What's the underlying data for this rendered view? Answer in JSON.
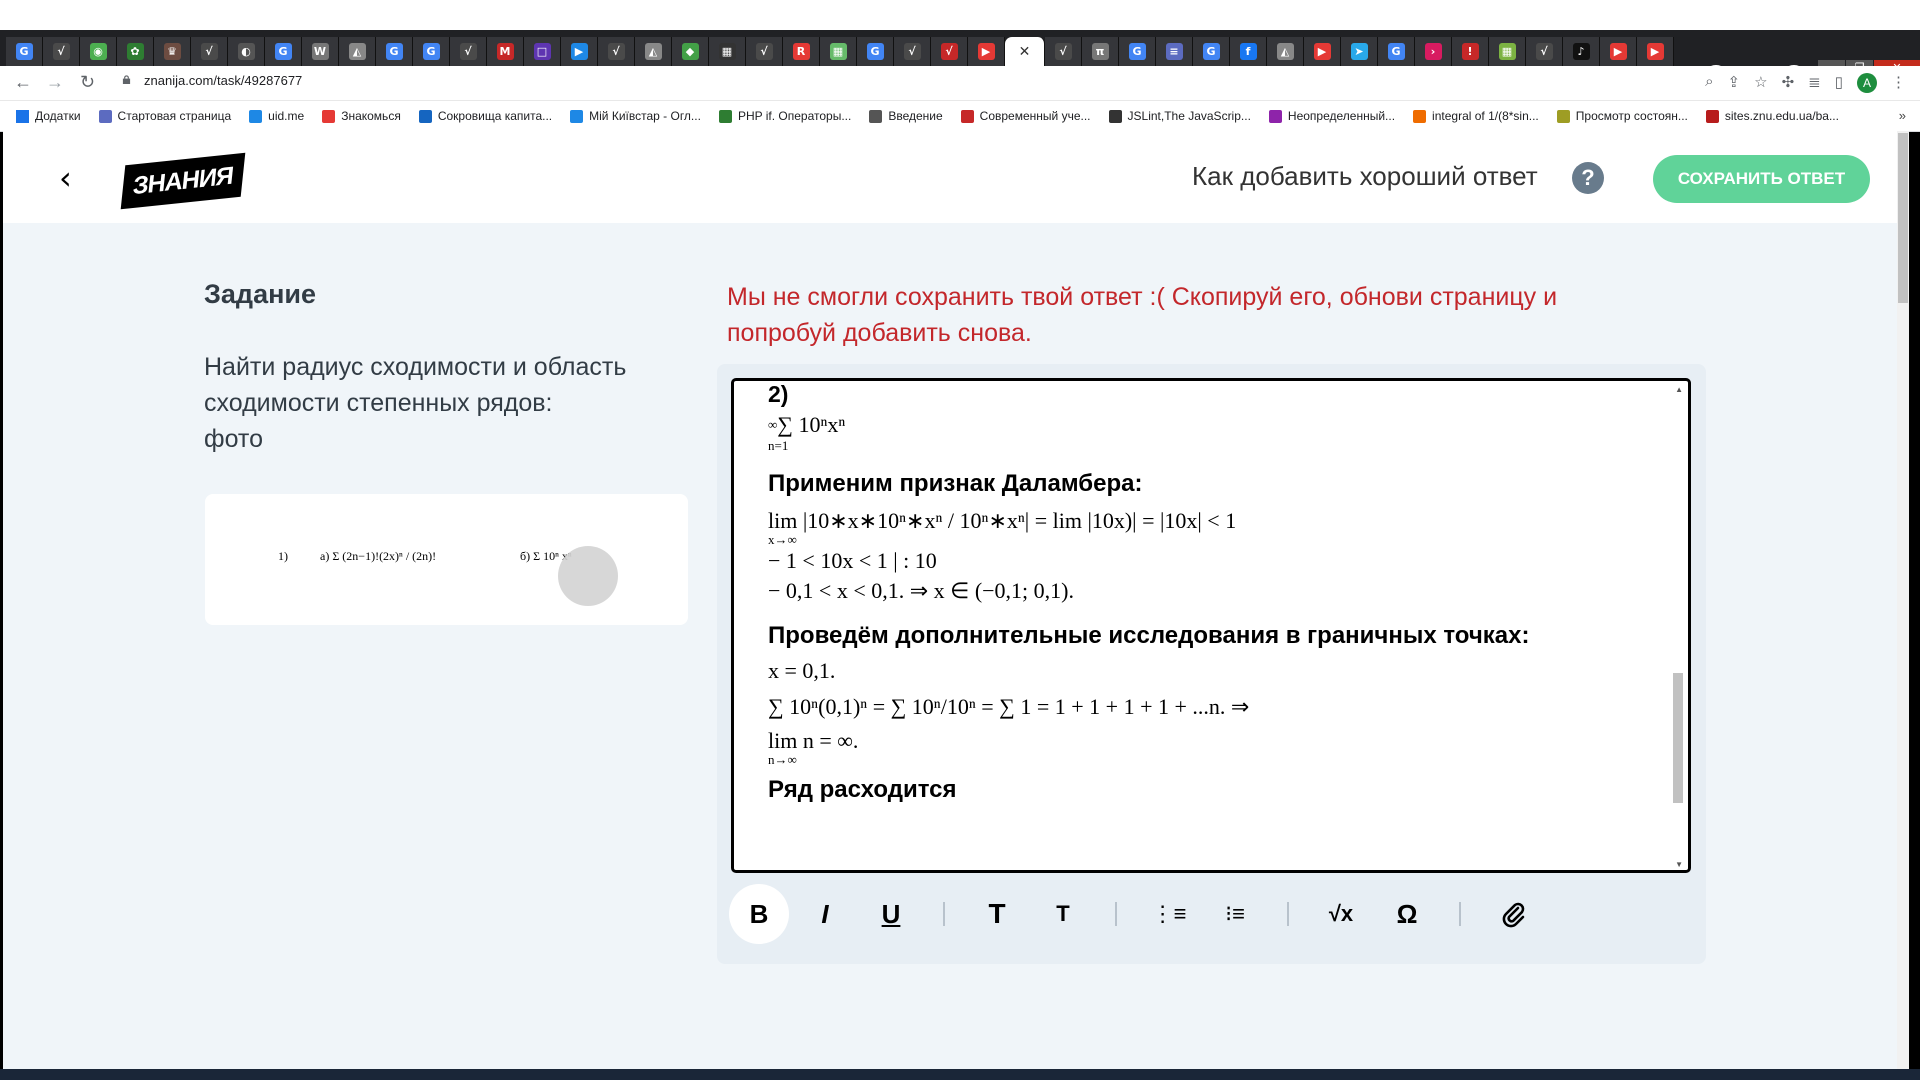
{
  "browser": {
    "url": "znanija.com/task/49287677",
    "tab_favicons": [
      {
        "glyph": "G",
        "color": "#4285f4"
      },
      {
        "glyph": "√",
        "color": "#4a4a4a"
      },
      {
        "glyph": "◉",
        "color": "#4caf50"
      },
      {
        "glyph": "✿",
        "color": "#2e7d32"
      },
      {
        "glyph": "♛",
        "color": "#6d4c41"
      },
      {
        "glyph": "√",
        "color": "#4a4a4a"
      },
      {
        "glyph": "◐",
        "color": "#555"
      },
      {
        "glyph": "G",
        "color": "#4285f4"
      },
      {
        "glyph": "W",
        "color": "#777"
      },
      {
        "glyph": "◭",
        "color": "#888"
      },
      {
        "glyph": "G",
        "color": "#4285f4"
      },
      {
        "glyph": "G",
        "color": "#4285f4"
      },
      {
        "glyph": "√",
        "color": "#4a4a4a"
      },
      {
        "glyph": "M",
        "color": "#c62828"
      },
      {
        "glyph": "□",
        "color": "#5e35b1"
      },
      {
        "glyph": "▶",
        "color": "#1e88e5"
      },
      {
        "glyph": "√",
        "color": "#4a4a4a"
      },
      {
        "glyph": "◭",
        "color": "#888"
      },
      {
        "glyph": "◆",
        "color": "#43a047"
      },
      {
        "glyph": "▦",
        "color": "#333"
      },
      {
        "glyph": "√",
        "color": "#4a4a4a"
      },
      {
        "glyph": "R",
        "color": "#e53935"
      },
      {
        "glyph": "▦",
        "color": "#66bb6a"
      },
      {
        "glyph": "G",
        "color": "#4285f4"
      },
      {
        "glyph": "√",
        "color": "#4a4a4a"
      },
      {
        "glyph": "√",
        "color": "#c62828"
      },
      {
        "glyph": "▶",
        "color": "#e53935"
      },
      {
        "glyph": "✕",
        "color": "#333"
      },
      {
        "glyph": "√",
        "color": "#4a4a4a"
      },
      {
        "glyph": "π",
        "color": "#777"
      },
      {
        "glyph": "G",
        "color": "#4285f4"
      },
      {
        "glyph": "≡",
        "color": "#5c6bc0"
      },
      {
        "glyph": "G",
        "color": "#4285f4"
      },
      {
        "glyph": "f",
        "color": "#1877f2"
      },
      {
        "glyph": "◭",
        "color": "#888"
      },
      {
        "glyph": "▶",
        "color": "#e53935"
      },
      {
        "glyph": "➤",
        "color": "#29a9ea"
      },
      {
        "glyph": "G",
        "color": "#4285f4"
      },
      {
        "glyph": "›",
        "color": "#d81b60"
      },
      {
        "glyph": "!",
        "color": "#c62828"
      },
      {
        "glyph": "▦",
        "color": "#7cb342"
      },
      {
        "glyph": "√",
        "color": "#4a4a4a"
      },
      {
        "glyph": "♪",
        "color": "#111"
      },
      {
        "glyph": "▶",
        "color": "#e53935"
      },
      {
        "glyph": "▶",
        "color": "#e53935"
      }
    ],
    "active_tab_index": 27,
    "new_tab_label": "+",
    "profile_initial": "A",
    "bookmarks": [
      {
        "label": "Додатки",
        "color": "#1a73e8"
      },
      {
        "label": "Стартовая страница",
        "color": "#5c6bc0"
      },
      {
        "label": "uid.me",
        "color": "#1e88e5"
      },
      {
        "label": "Знакомься",
        "color": "#e53935"
      },
      {
        "label": "Сокровища капита...",
        "color": "#1565c0"
      },
      {
        "label": "Мій Київстар - Огл...",
        "color": "#1e88e5"
      },
      {
        "label": "PHP if. Операторы...",
        "color": "#2e7d32"
      },
      {
        "label": "Введение",
        "color": "#555"
      },
      {
        "label": "Современный уче...",
        "color": "#c62828"
      },
      {
        "label": "JSLint,The JavaScrip...",
        "color": "#333"
      },
      {
        "label": "Неопределенный...",
        "color": "#8e24aa"
      },
      {
        "label": "integral of 1/(8*sin...",
        "color": "#ef6c00"
      },
      {
        "label": "Просмотр состоян...",
        "color": "#9e9d24"
      },
      {
        "label": "sites.znu.edu.ua/ba...",
        "color": "#b71c1c"
      }
    ],
    "bookmarks_more": "»"
  },
  "header": {
    "back_glyph": "‹",
    "logo_text": "ЗНАНИЯ",
    "help_text": "Как добавить хороший ответ",
    "help_glyph": "?",
    "save_button": "СОХРАНИТЬ ОТВЕТ"
  },
  "task": {
    "heading": "Задание",
    "lines": [
      "Найти радиус сходимости и область",
      "сходимости степенных рядов:",
      "фото"
    ],
    "attachment": {
      "item1": "1)",
      "item_a": "а) Σ (2n−1)!(2x)ⁿ / (2n)!",
      "item_b": "б) Σ 10ⁿ xⁿ"
    }
  },
  "error_message": "Мы не смогли сохранить твой ответ :( Скопируй его, обнови страницу и попробуй добавить снова.",
  "editor": {
    "content": {
      "part_label": "2)",
      "series": "∑ 10ⁿxⁿ",
      "series_limits": {
        "top": "∞",
        "bottom": "n=1"
      },
      "heading1": "Применим признак Даламбера:",
      "lim_line": "lim |10∗x∗10ⁿ∗xⁿ / 10ⁿ∗xⁿ| = lim |10x)| = |10x| < 1",
      "lim_sub": "x→∞",
      "ineq1": "− 1 < 10x < 1 | : 10",
      "ineq2": "− 0,1 < x < 0,1.      ⇒      x ∈ (−0,1; 0,1).",
      "heading2": "Проведём дополнительные исследования в граничных точках:",
      "x_val": "x = 0,1.",
      "sum_line": "∑ 10ⁿ(0,1)ⁿ = ∑ 10ⁿ/10ⁿ = ∑ 1 = 1 + 1 + 1 + 1 + ...n.      ⇒",
      "lim2": "lim  n = ∞.",
      "lim2_sub": "n→∞",
      "conclusion": "Ряд расходится"
    },
    "toolbar": {
      "bold": "B",
      "italic": "I",
      "underline": "U",
      "heading_large": "T",
      "heading_small": "T",
      "ordered_list": "⋮≡",
      "bullet_list": "⁝≡",
      "formula": "√x",
      "omega": "Ω",
      "attach": "⌀"
    }
  }
}
